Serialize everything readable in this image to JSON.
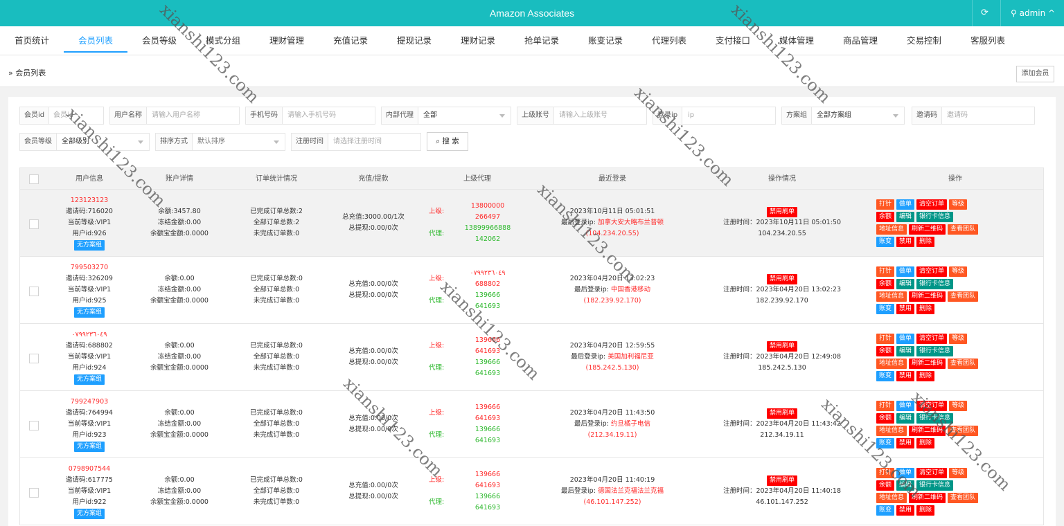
{
  "topbar": {
    "title": "Amazon Associates",
    "refresh_icon": "refresh-icon",
    "user": "admin ^",
    "color": "#19bdbf"
  },
  "nav": {
    "items": [
      "首页统计",
      "会员列表",
      "会员等级",
      "模式分组",
      "理财管理",
      "充值记录",
      "提现记录",
      "理财记录",
      "抢单记录",
      "账变记录",
      "代理列表",
      "支付接口",
      "媒体管理",
      "商品管理",
      "交易控制",
      "客服列表"
    ],
    "active": "会员列表"
  },
  "breadcrumb": {
    "text": "» 会员列表",
    "add_button": "添加会员"
  },
  "filters": {
    "id": {
      "label": "会员id",
      "placeholder": "会员id"
    },
    "username": {
      "label": "用户名称",
      "placeholder": "请输入用户名称"
    },
    "phone": {
      "label": "手机号码",
      "placeholder": "请输入手机号码"
    },
    "agent": {
      "label": "内部代理",
      "value": "全部"
    },
    "parent": {
      "label": "上级账号",
      "placeholder": "请输入上级账号"
    },
    "ip": {
      "label": "登录ip",
      "placeholder": "ip"
    },
    "plan_group": {
      "label": "方案组",
      "value": "全部方案组"
    },
    "invite": {
      "label": "邀请码",
      "placeholder": "邀请码"
    },
    "level": {
      "label": "会员等级",
      "value": "全部级别"
    },
    "sort": {
      "label": "排序方式",
      "value": "默认排序"
    },
    "regtime": {
      "label": "注册时间",
      "placeholder": "请选择注册时间"
    },
    "search_button": "搜 索"
  },
  "table": {
    "headers": [
      "用户信息",
      "账户详情",
      "订单统计情况",
      "充值/提款",
      "上级代理",
      "最近登录",
      "操作情况",
      "操作"
    ],
    "rows": [
      {
        "phone": "123123123",
        "invite": "邀请码:716020",
        "level": "当前等级:VIP1",
        "uid": "用户id:926",
        "plan": "无方案组",
        "balance": "余额:3457.80",
        "frozen": "冻结金额:0.00",
        "yeb": "余额宝金额:0.0000",
        "done": "已完成订单总数:2",
        "all": "全部订单总数:2",
        "undone": "未完成订单数:0",
        "recharge": "总充值:3000.00/1次",
        "withdraw": "总提现:0.00/0次",
        "up_label": "上级:",
        "up1": "13800000",
        "up2": "266497",
        "agent_label": "代理:",
        "ag1": "13899966888",
        "ag2": "142062",
        "last_time": "2023年10月11日 05:01:51",
        "last_ip_label": "最后登录ip:",
        "last_ip_loc": "加拿大安大略布兰普顿",
        "last_ip": "(104.234.20.55)",
        "ban": "禁用刷单",
        "reg_time": "注册时间：2023年10月11日 05:01:50",
        "reg_ip": "104.234.20.55"
      },
      {
        "phone": "799503270",
        "invite": "邀请码:326209",
        "level": "当前等级:VIP1",
        "uid": "用户id:925",
        "plan": "无方案组",
        "balance": "余额:0.00",
        "frozen": "冻结金额:0.00",
        "yeb": "余额宝金额:0.0000",
        "done": "已完成订单总数:0",
        "all": "全部订单总数:0",
        "undone": "未完成订单数:0",
        "recharge": "总充值:0.00/0次",
        "withdraw": "总提现:0.00/0次",
        "up_label": "上级:",
        "up1": "٠٧٩٩٢٣٦٠٤٩",
        "up2": "688802",
        "agent_label": "代理:",
        "ag1": "139666",
        "ag2": "641693",
        "last_time": "2023年04月20日 13:02:23",
        "last_ip_label": "最后登录ip:",
        "last_ip_loc": "中国香港移动",
        "last_ip": "(182.239.92.170)",
        "ban": "禁用刷单",
        "reg_time": "注册时间：2023年04月20日 13:02:23",
        "reg_ip": "182.239.92.170"
      },
      {
        "phone": "٠٧٩٩٢٣٦٠٤٩",
        "invite": "邀请码:688802",
        "level": "当前等级:VIP1",
        "uid": "用户id:924",
        "plan": "无方案组",
        "balance": "余额:0.00",
        "frozen": "冻结金额:0.00",
        "yeb": "余额宝金额:0.0000",
        "done": "已完成订单总数:0",
        "all": "全部订单总数:0",
        "undone": "未完成订单数:0",
        "recharge": "总充值:0.00/0次",
        "withdraw": "总提现:0.00/0次",
        "up_label": "上级:",
        "up1": "139666",
        "up2": "641693",
        "agent_label": "代理:",
        "ag1": "139666",
        "ag2": "641693",
        "last_time": "2023年04月20日 12:59:55",
        "last_ip_label": "最后登录ip:",
        "last_ip_loc": "美国加利福尼亚",
        "last_ip": "(185.242.5.130)",
        "ban": "禁用刷单",
        "reg_time": "注册时间：2023年04月20日 12:49:08",
        "reg_ip": "185.242.5.130"
      },
      {
        "phone": "799247903",
        "invite": "邀请码:764994",
        "level": "当前等级:VIP1",
        "uid": "用户id:923",
        "plan": "无方案组",
        "balance": "余额:0.00",
        "frozen": "冻结金额:0.00",
        "yeb": "余额宝金额:0.0000",
        "done": "已完成订单总数:0",
        "all": "全部订单总数:0",
        "undone": "未完成订单数:0",
        "recharge": "总充值:0.00/0次",
        "withdraw": "总提现:0.00/0次",
        "up_label": "上级:",
        "up1": "139666",
        "up2": "641693",
        "agent_label": "代理:",
        "ag1": "139666",
        "ag2": "641693",
        "last_time": "2023年04月20日 11:43:50",
        "last_ip_label": "最后登录ip:",
        "last_ip_loc": "约旦橘子电信",
        "last_ip": "(212.34.19.11)",
        "ban": "禁用刷单",
        "reg_time": "注册时间：2023年04月20日 11:43:42",
        "reg_ip": "212.34.19.11"
      },
      {
        "phone": "0798907544",
        "invite": "邀请码:617775",
        "level": "当前等级:VIP1",
        "uid": "用户id:922",
        "plan": "无方案组",
        "balance": "余额:0.00",
        "frozen": "冻结金额:0.00",
        "yeb": "余额宝金额:0.0000",
        "done": "已完成订单总数:0",
        "all": "全部订单总数:0",
        "undone": "未完成订单数:0",
        "recharge": "总充值:0.00/0次",
        "withdraw": "总提现:0.00/0次",
        "up_label": "上级:",
        "up1": "139666",
        "up2": "641693",
        "agent_label": "代理:",
        "ag1": "139666",
        "ag2": "641693",
        "last_time": "2023年04月20日 11:40:19",
        "last_ip_label": "最后登录ip:",
        "last_ip_loc": "德国法兰克福法兰克福",
        "last_ip": "(46.101.147.252)",
        "ban": "禁用刷单",
        "reg_time": "注册时间：2023年04月20日 11:40:18",
        "reg_ip": "46.101.147.252"
      }
    ],
    "ops": {
      "dakan": "打针",
      "zuodan": "做单",
      "clear": "清空订单",
      "level": "等级",
      "balance": "余额",
      "edit": "编辑",
      "bank": "银行卡信息",
      "address": "地址信息",
      "qrcode": "刷新二维码",
      "team": "查看团队",
      "zhangbian": "账变",
      "disable": "禁用",
      "delete": "删除"
    }
  },
  "watermark": "xianshi123.com"
}
